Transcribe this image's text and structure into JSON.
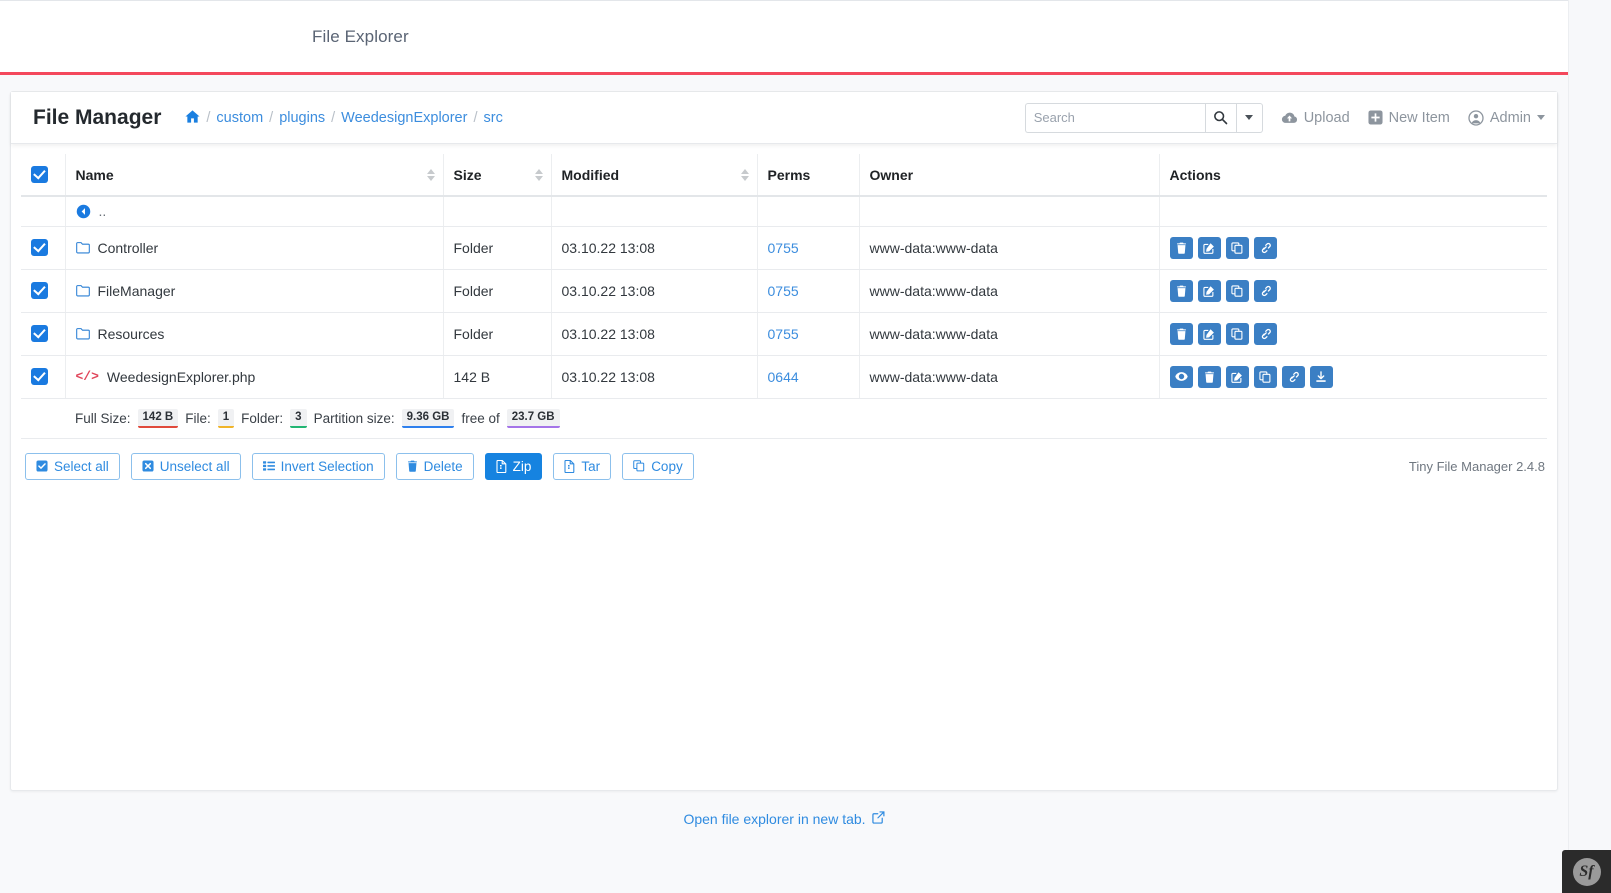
{
  "appbar": {
    "title": "File Explorer",
    "accent_color": "#f4485c"
  },
  "file_manager": {
    "brand": "File Manager",
    "breadcrumb": {
      "home_icon": "home-icon",
      "items": [
        "custom",
        "plugins",
        "WeedesignExplorer",
        "src"
      ],
      "separator": "/"
    },
    "search": {
      "placeholder": "Search",
      "value": "",
      "icon": "search-icon",
      "dropdown_icon": "chevron-down-icon"
    },
    "header_actions": [
      {
        "label": "Upload",
        "icon": "cloud-upload-icon"
      },
      {
        "label": "New Item",
        "icon": "plus-square-icon"
      },
      {
        "label": "Admin",
        "icon": "user-circle-icon",
        "caret": true
      }
    ]
  },
  "table": {
    "columns": [
      {
        "key": "check",
        "label": "",
        "sortable": false
      },
      {
        "key": "name",
        "label": "Name",
        "sortable": true
      },
      {
        "key": "size",
        "label": "Size",
        "sortable": true
      },
      {
        "key": "modified",
        "label": "Modified",
        "sortable": true
      },
      {
        "key": "perms",
        "label": "Perms",
        "sortable": false
      },
      {
        "key": "owner",
        "label": "Owner",
        "sortable": false
      },
      {
        "key": "actions",
        "label": "Actions",
        "sortable": false
      }
    ],
    "parent_row": {
      "label": "..",
      "icon": "back-circle-icon"
    },
    "rows": [
      {
        "checked": true,
        "icon": "folder-icon",
        "name": "Controller",
        "size": "Folder",
        "modified": "03.10.22 13:08",
        "perms": "0755",
        "owner": "www-data:www-data",
        "actions": [
          "delete-icon",
          "rename-icon",
          "copy-icon",
          "link-icon"
        ]
      },
      {
        "checked": true,
        "icon": "folder-icon",
        "name": "FileManager",
        "size": "Folder",
        "modified": "03.10.22 13:08",
        "perms": "0755",
        "owner": "www-data:www-data",
        "actions": [
          "delete-icon",
          "rename-icon",
          "copy-icon",
          "link-icon"
        ]
      },
      {
        "checked": true,
        "icon": "folder-icon",
        "name": "Resources",
        "size": "Folder",
        "modified": "03.10.22 13:08",
        "perms": "0755",
        "owner": "www-data:www-data",
        "actions": [
          "delete-icon",
          "rename-icon",
          "copy-icon",
          "link-icon"
        ]
      },
      {
        "checked": true,
        "icon": "code-file-icon",
        "name": "WeedesignExplorer.php",
        "size": "142 B",
        "modified": "03.10.22 13:08",
        "perms": "0644",
        "owner": "www-data:www-data",
        "actions": [
          "view-icon",
          "delete-icon",
          "rename-icon",
          "copy-icon",
          "link-icon",
          "download-icon"
        ]
      }
    ],
    "summary": {
      "full_size_label": "Full Size:",
      "full_size_value": "142 B",
      "file_label": "File:",
      "file_value": "1",
      "folder_label": "Folder:",
      "folder_value": "3",
      "partition_label": "Partition size:",
      "partition_value": "9.36 GB",
      "free_of_label": "free of",
      "total_value": "23.7 GB"
    }
  },
  "toolbar": {
    "buttons": [
      {
        "label": "Select all",
        "icon": "check-square-icon",
        "active": false
      },
      {
        "label": "Unselect all",
        "icon": "x-square-icon",
        "active": false
      },
      {
        "label": "Invert Selection",
        "icon": "list-icon",
        "active": false
      },
      {
        "label": "Delete",
        "icon": "trash-icon",
        "active": false
      },
      {
        "label": "Zip",
        "icon": "file-archive-icon",
        "active": true
      },
      {
        "label": "Tar",
        "icon": "file-archive-icon",
        "active": false
      },
      {
        "label": "Copy",
        "icon": "copy-icon",
        "active": false
      }
    ],
    "version": "Tiny File Manager 2.4.8"
  },
  "footer": {
    "link_label": "Open file explorer in new tab.",
    "link_icon": "external-link-icon"
  },
  "profiler_badge": {
    "label": "Sf",
    "name": "symfony-profiler-badge"
  }
}
